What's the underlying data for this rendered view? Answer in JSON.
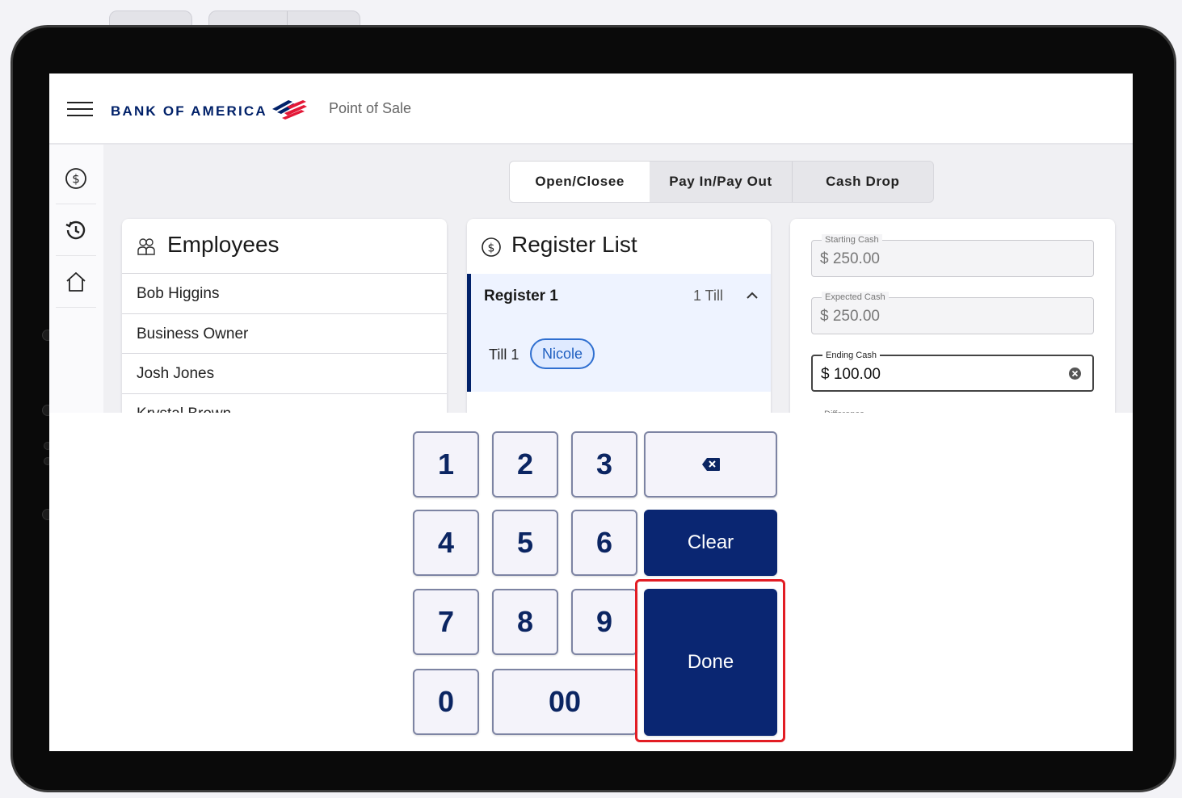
{
  "app": {
    "brand": "BANK OF AMERICA",
    "title": "Point of Sale"
  },
  "rail": [
    "dollar-circle-icon",
    "history-icon",
    "home-icon"
  ],
  "tabs": [
    "Open/Closee",
    "Pay In/Pay Out",
    "Cash Drop"
  ],
  "employees": {
    "title": "Employees",
    "items": [
      "Bob Higgins",
      "Business Owner",
      "Josh Jones",
      "Krystal Brown"
    ]
  },
  "registers": {
    "title": "Register List",
    "register_name": "Register 1",
    "till_count": "1 Till",
    "till_label": "Till 1",
    "till_user": "Nicole"
  },
  "cash": {
    "starting_label": "Starting Cash",
    "starting_value": "$ 250.00",
    "expected_label": "Expected Cash",
    "expected_value": "$ 250.00",
    "ending_label": "Ending Cash",
    "ending_value": "$ 100.00",
    "difference_label": "Difference"
  },
  "keypad": {
    "digits": [
      "1",
      "2",
      "3",
      "4",
      "5",
      "6",
      "7",
      "8",
      "9",
      "0",
      "00"
    ],
    "clear_label": "Clear",
    "done_label": "Done"
  },
  "colors": {
    "brand_navy": "#012169",
    "brand_red": "#e31837",
    "key_dark": "#0a2672",
    "highlight": "#e21d24"
  }
}
